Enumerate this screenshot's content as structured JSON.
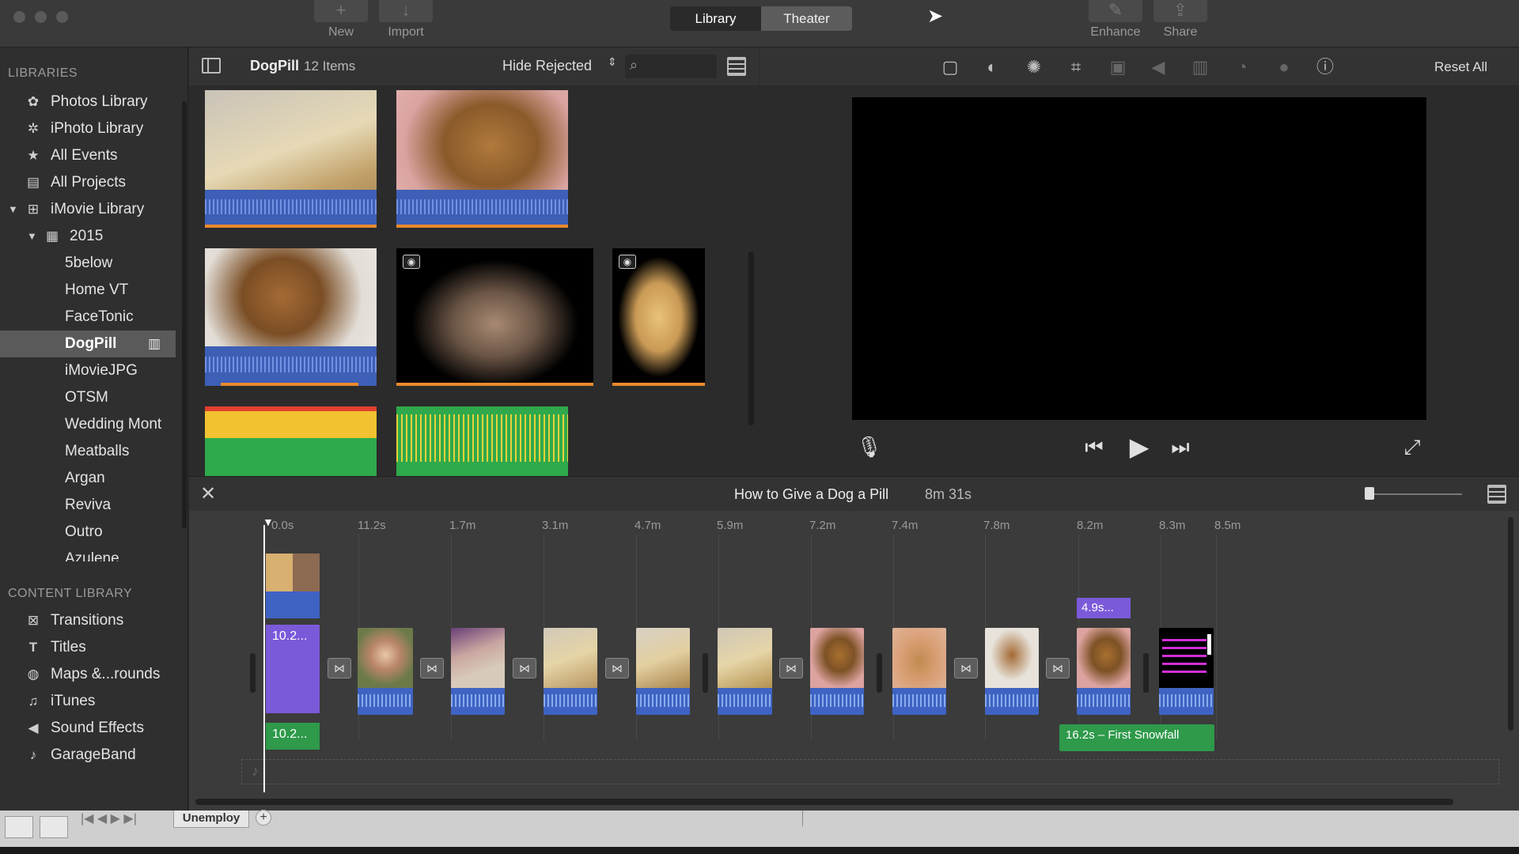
{
  "toolbar": {
    "new_label": "New",
    "import_label": "Import",
    "enhance_label": "Enhance",
    "share_label": "Share",
    "library_tab": "Library",
    "theater_tab": "Theater"
  },
  "sidebar": {
    "libraries_header": "LIBRARIES",
    "libraries": [
      {
        "label": "Photos Library"
      },
      {
        "label": "iPhoto Library"
      },
      {
        "label": "All Events"
      },
      {
        "label": "All Projects"
      },
      {
        "label": "iMovie Library"
      },
      {
        "label": "2015"
      }
    ],
    "events": [
      "5below",
      "Home VT",
      "FaceTonic",
      "DogPill",
      "iMovieJPG",
      "OTSM",
      "Wedding Mont",
      "Meatballs",
      "Argan",
      "Reviva",
      "Outro",
      "Azulene"
    ],
    "selected_event": "DogPill",
    "content_header": "CONTENT LIBRARY",
    "content": [
      {
        "label": "Transitions"
      },
      {
        "label": "Titles"
      },
      {
        "label": "Maps &...rounds"
      },
      {
        "label": "iTunes"
      },
      {
        "label": "Sound Effects"
      },
      {
        "label": "GarageBand"
      }
    ]
  },
  "browser": {
    "event_name": "DogPill",
    "item_count": "12 Items",
    "filter": "Hide Rejected"
  },
  "viewer": {
    "reset_all": "Reset All"
  },
  "timeline": {
    "project_title": "How to Give a Dog a Pill",
    "duration": "8m 31s",
    "ticks": [
      "0.0s",
      "11.2s",
      "1.7m",
      "3.1m",
      "4.7m",
      "5.9m",
      "7.2m",
      "7.4m",
      "7.8m",
      "8.2m",
      "8.3m",
      "8.5m"
    ],
    "badge_title_top": "10.2...",
    "badge_title_bottom": "10.2...",
    "badge_clip": "4.9s...",
    "music_label": "16.2s – First Snowfall"
  },
  "bottom": {
    "tab_label": "Unemploy",
    "add_label": "+"
  },
  "colors": {
    "accent_purple": "#7b5ad9",
    "audio_blue": "#3e63c3",
    "music_green": "#2e9a4a",
    "selection_gray": "#5a5a5a"
  }
}
